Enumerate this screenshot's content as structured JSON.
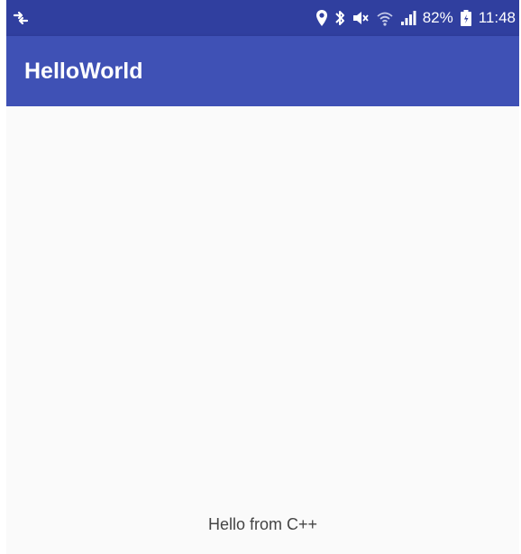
{
  "status_bar": {
    "battery": "82%",
    "time": "11:48",
    "icons": [
      "sync-icon",
      "location-icon",
      "bluetooth-icon",
      "mute-icon",
      "wifi-icon",
      "signal-icon",
      "battery-icon"
    ],
    "background_color": "#303f9f"
  },
  "app_bar": {
    "title": "HelloWorld",
    "background_color": "#3f51b5"
  },
  "content": {
    "message": "Hello from C++",
    "background_color": "#fafafa"
  }
}
